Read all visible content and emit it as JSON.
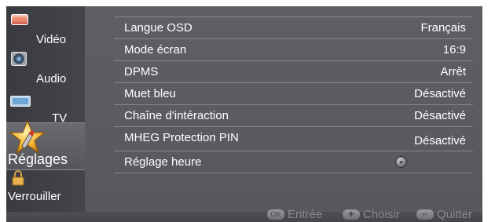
{
  "sidebar": {
    "items": [
      {
        "label": "Vidéo",
        "icon": "video-icon",
        "active": false
      },
      {
        "label": "Audio",
        "icon": "audio-icon",
        "active": false
      },
      {
        "label": "TV",
        "icon": "tv-icon",
        "active": false
      },
      {
        "label": "Réglages",
        "icon": "settings-star-icon",
        "active": true
      },
      {
        "label": "Verrouiller",
        "icon": "lock-icon",
        "active": false
      }
    ]
  },
  "menu": {
    "rows": [
      {
        "label": "Langue OSD",
        "value": "Français"
      },
      {
        "label": "Mode écran",
        "value": "16:9"
      },
      {
        "label": "DPMS",
        "value": "Arrêt"
      },
      {
        "label": "Muet bleu",
        "value": "Désactivé"
      },
      {
        "label": "Chaîne d'intéraction",
        "value": "Désactivé"
      },
      {
        "label": "MHEG Protection PIN",
        "value": "Désactivé"
      },
      {
        "label": "Réglage heure",
        "value": ""
      }
    ]
  },
  "bottom_bar": {
    "enter_label": "Entrée",
    "choose_label": "Choisir",
    "quit_label": "Quitter"
  },
  "colors": {
    "panel": "#5a5b61",
    "sidebar": "#3f4045",
    "text": "#ffffff",
    "hint_text": "#8a8b90"
  }
}
